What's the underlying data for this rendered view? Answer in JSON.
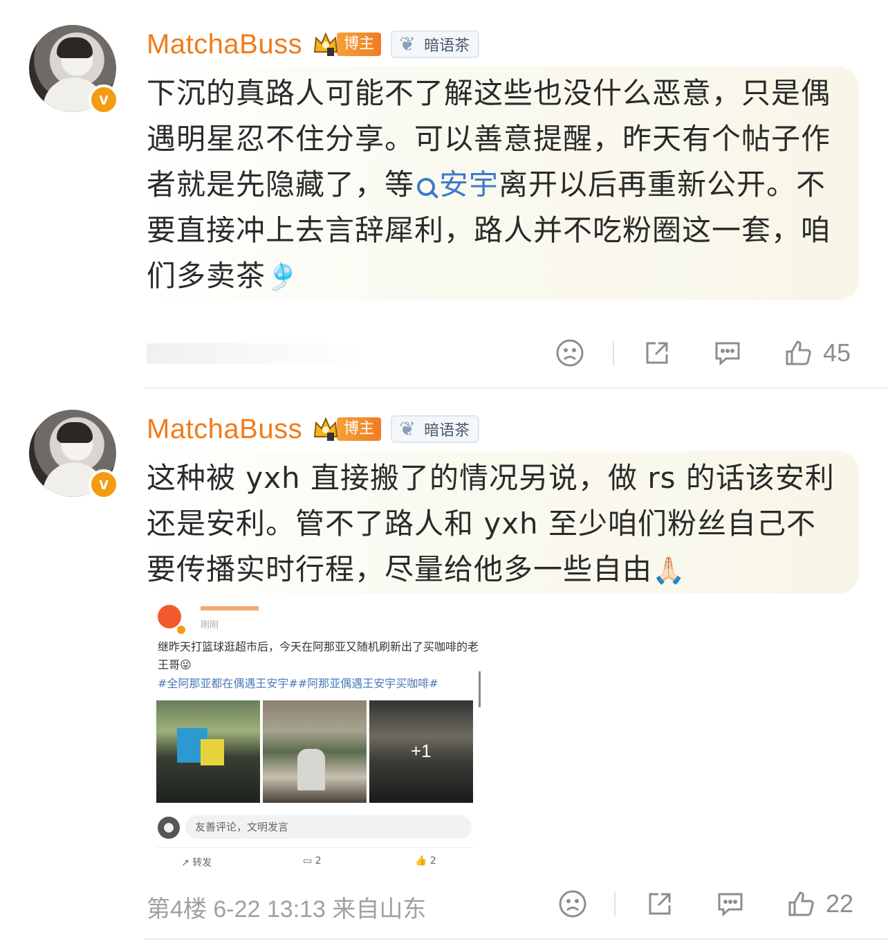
{
  "comments": [
    {
      "username": "MatchaBuss",
      "host_badge": "博主",
      "tea_badge": "暗语茶",
      "text_before": "下沉的真路人可能不了解这些也没什么恶意，只是偶遇明星忍不住分享。可以善意提醒，昨天有个帖子作者就是先隐藏了，等",
      "topic_link": "安宇",
      "text_after": "离开以后再重新公开。不要直接冲上去言辞犀利，路人并不吃粉圈这一套，咱们多卖茶",
      "emoji": "🎐",
      "like_count": "45"
    },
    {
      "username": "MatchaBuss",
      "host_badge": "博主",
      "tea_badge": "暗语茶",
      "text": "这种被 yxh 直接搬了的情况另说，做 rs 的话该安利还是安利。管不了路人和 yxh 至少咱们粉丝自己不要传播实时行程，尽量给他多一些自由",
      "emoji": "🙏🏻",
      "meta": "第4楼 6-22 13:13 来自山东",
      "like_count": "22",
      "embedded_post": {
        "time": "刚刚",
        "text": "继昨天打篮球逛超市后，今天在阿那亚又随机刷新出了买咖啡的老王哥",
        "text_emoji": "😜",
        "tags": "#全阿那亚都在偶遇王安宇##阿那亚偶遇王安宇买咖啡#",
        "more_images": "+1",
        "comment_placeholder": "友善评论，文明发言",
        "repost_label": "转发",
        "comment_count": "2",
        "like_count": "2"
      }
    }
  ],
  "icons": {
    "dislike": "sad-face-icon",
    "share": "share-icon",
    "comment": "comment-icon",
    "like": "thumbs-up-icon",
    "search": "search-icon"
  },
  "colors": {
    "username": "#f07b1a",
    "link": "#3b7bc6",
    "meta": "#a0a0a0"
  }
}
